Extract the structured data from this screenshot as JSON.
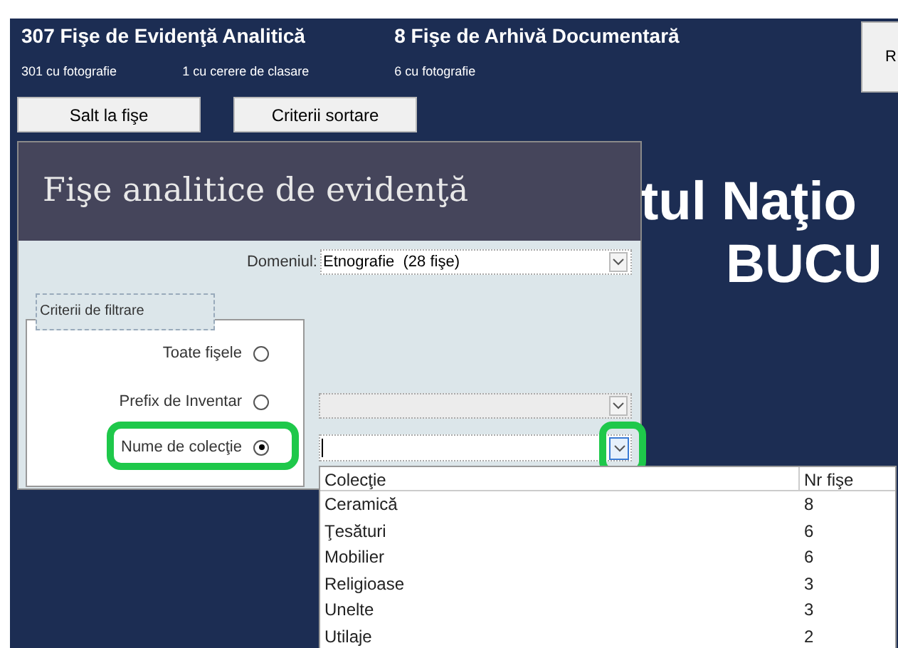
{
  "header": {
    "groups": [
      {
        "title": "307 Fişe de Evidenţă Analitică",
        "stats": [
          "301 cu fotografie",
          "1 cu cerere de clasare"
        ]
      },
      {
        "title": "8 Fişe de Arhivă Documentară",
        "stats": [
          "6 cu fotografie"
        ]
      }
    ],
    "corner_button": "R"
  },
  "nav_buttons": [
    "Salt la fişe",
    "Criterii sortare"
  ],
  "banner": [
    "tul Naţio",
    "BUCU"
  ],
  "dialog": {
    "title": "Fişe analitice de evidenţă",
    "domain": {
      "label": "Domeniul:",
      "value": "Etnografie  (28 fişe)"
    },
    "filter_group": {
      "legend": "Criterii de filtrare",
      "options": [
        {
          "label": "Toate fişele",
          "selected": false,
          "kind": "none",
          "highlighted": false
        },
        {
          "label": "Prefix de Inventar",
          "selected": false,
          "kind": "disabled",
          "highlighted": false
        },
        {
          "label": "Nume de colecţie",
          "selected": true,
          "kind": "open",
          "highlighted": true
        }
      ]
    }
  },
  "dropdown": {
    "columns": [
      "Colecţie",
      "Nr fişe"
    ],
    "rows": [
      [
        "Ceramică",
        "8"
      ],
      [
        "Ţesături",
        "6"
      ],
      [
        "Mobilier",
        "6"
      ],
      [
        "Religioase",
        "3"
      ],
      [
        "Unelte",
        "3"
      ],
      [
        "Utilaje",
        "2"
      ]
    ]
  }
}
